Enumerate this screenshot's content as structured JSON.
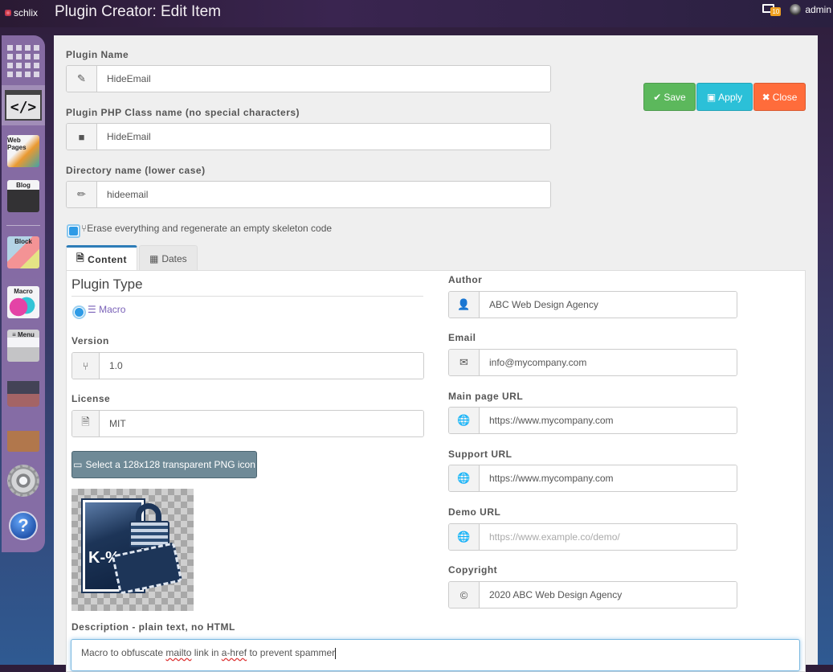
{
  "app": {
    "brand": "schlix",
    "title": "Plugin Creator: Edit Item",
    "notification_count": "10",
    "user": "admin"
  },
  "sidebar": {
    "items": [
      {
        "name": "apps-grid",
        "icon": "grid-icon",
        "active": false
      },
      {
        "name": "plugin-creator",
        "icon": "code-icon",
        "label": "</>",
        "active": true
      },
      {
        "name": "web-pages",
        "icon": "web-pages-icon",
        "label": "Web Pages",
        "active": false
      },
      {
        "name": "blog",
        "icon": "blog-icon",
        "label": "Blog",
        "active": false
      },
      {
        "name": "blocks",
        "icon": "block-icon",
        "label": "Block",
        "active": false
      },
      {
        "name": "macro",
        "icon": "macro-icon",
        "label": "Macro",
        "active": false
      },
      {
        "name": "menu",
        "icon": "menu-icon",
        "label": "≡ Menu",
        "active": false
      },
      {
        "name": "users",
        "icon": "users-icon",
        "active": false
      },
      {
        "name": "tools",
        "icon": "toolbox-icon",
        "active": false
      },
      {
        "name": "settings",
        "icon": "gear-icon",
        "active": false
      },
      {
        "name": "help",
        "icon": "help-icon",
        "label": "?",
        "active": false
      }
    ]
  },
  "toolbar": {
    "save_label": "Save",
    "apply_label": "Apply",
    "close_label": "Close",
    "colors": {
      "save": "#5cb85c",
      "apply": "#2bc0d8",
      "close": "#ff6c3b"
    }
  },
  "form": {
    "plugin_name": {
      "label": "Plugin Name",
      "value": "HideEmail",
      "icon": "edit-icon"
    },
    "php_class": {
      "label": "Plugin PHP Class name (no special characters)",
      "value": "HideEmail",
      "icon": "pencil-square-icon"
    },
    "directory": {
      "label": "Directory name (lower case)",
      "value": "hideemail",
      "icon": "pencil-icon"
    },
    "regenerate": {
      "label": "Erase everything and regenerate an empty skeleton code",
      "checked": true
    }
  },
  "tabs": [
    {
      "label": "Content",
      "icon": "file-icon",
      "active": true
    },
    {
      "label": "Dates",
      "icon": "calendar-icon",
      "active": false
    }
  ],
  "content": {
    "plugin_type_title": "Plugin Type",
    "plugin_type_option": {
      "label": "Macro",
      "selected": true
    },
    "version": {
      "label": "Version",
      "value": "1.0",
      "icon": "branch-icon"
    },
    "license": {
      "label": "License",
      "value": "MIT",
      "icon": "file-text-icon"
    },
    "icon_button": "Select a 128x128 transparent PNG icon",
    "author": {
      "label": "Author",
      "value": "ABC Web Design Agency",
      "icon": "user-icon"
    },
    "email": {
      "label": "Email",
      "value": "info@mycompany.com",
      "icon": "envelope-icon"
    },
    "main_url": {
      "label": "Main page URL",
      "value": "https://www.mycompany.com",
      "icon": "globe-icon"
    },
    "support_url": {
      "label": "Support URL",
      "value": "https://www.mycompany.com",
      "icon": "globe-icon"
    },
    "demo_url": {
      "label": "Demo URL",
      "value": "",
      "placeholder": "https://www.example.co/demo/",
      "icon": "globe-icon"
    },
    "copyright": {
      "label": "Copyright",
      "value": "2020 ABC Web Design Agency",
      "icon": "copyright-icon"
    },
    "description": {
      "label": "Description - plain text, no HTML",
      "parts": [
        "Macro to obfuscate ",
        "mailto",
        " link in ",
        "a-href",
        " to prevent spammer"
      ]
    }
  }
}
